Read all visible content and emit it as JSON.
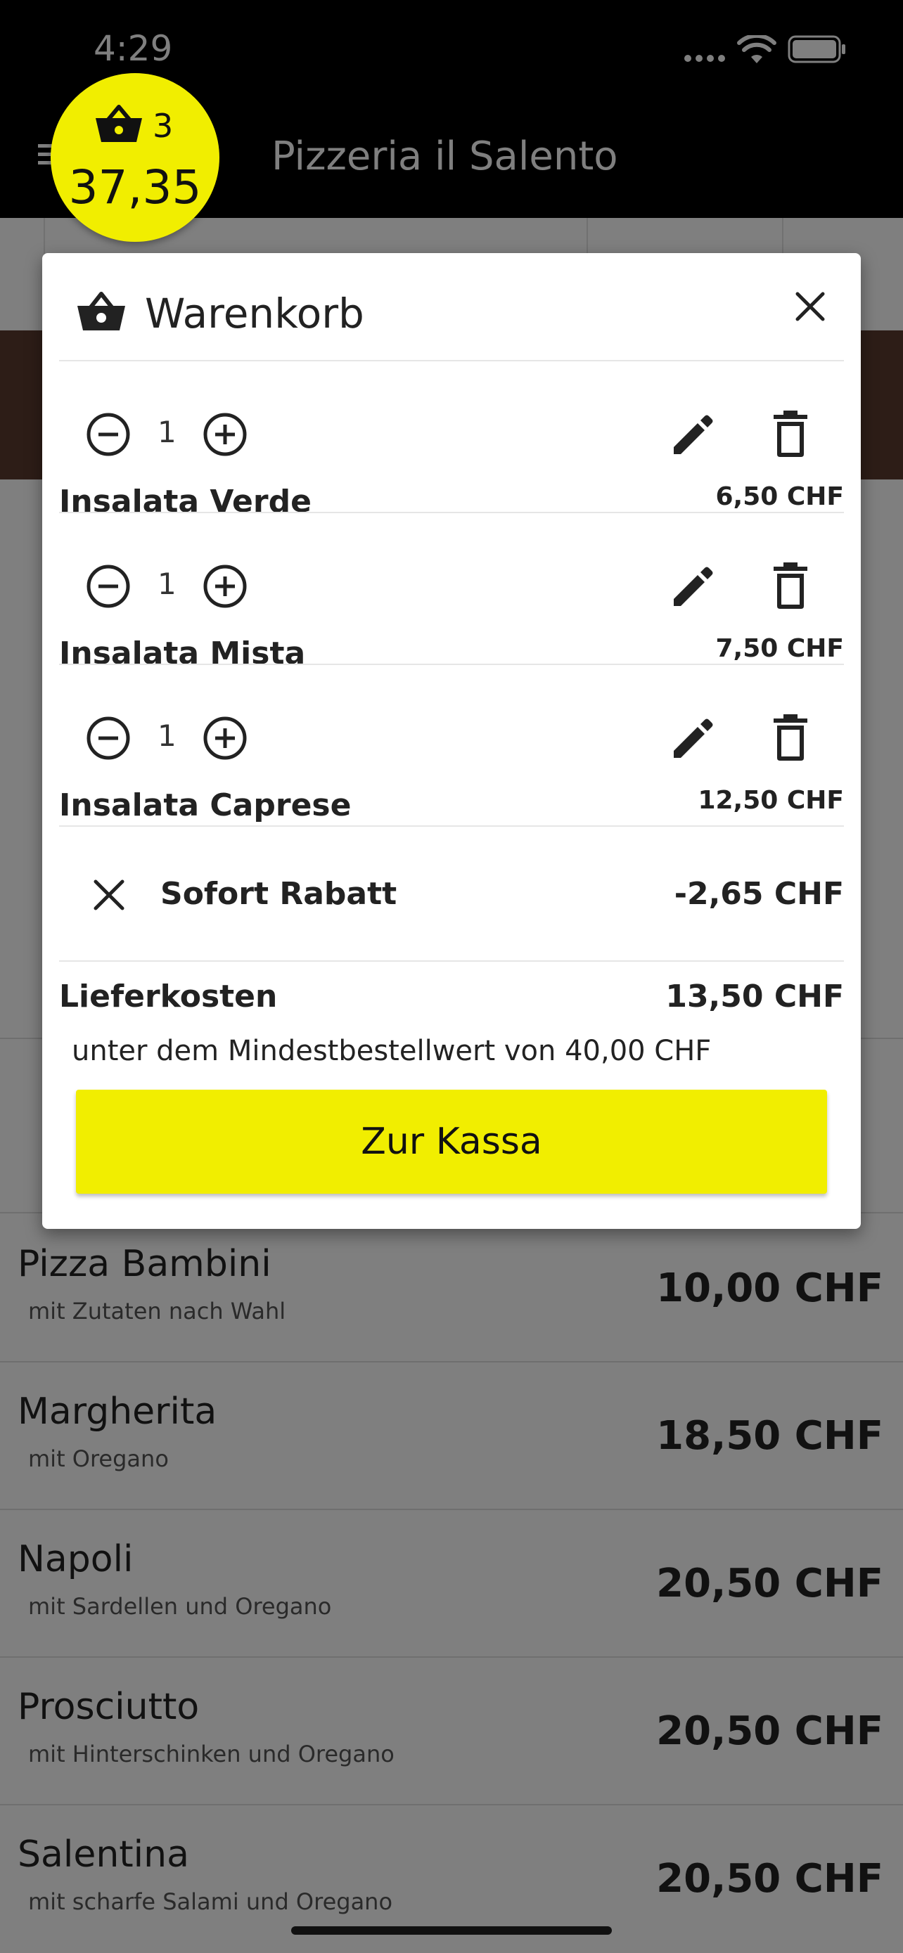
{
  "status_bar": {
    "time": "4:29"
  },
  "app_bar": {
    "title": "Pizzeria il Salento"
  },
  "cart_badge": {
    "count": "3",
    "total": "37,35"
  },
  "menu": [
    {
      "name": "Pizza Bambini",
      "desc": "mit Zutaten nach Wahl",
      "price": "10,00 CHF"
    },
    {
      "name": "Margherita",
      "desc": "mit Oregano",
      "price": "18,50 CHF"
    },
    {
      "name": "Napoli",
      "desc": "mit Sardellen und Oregano",
      "price": "20,50 CHF"
    },
    {
      "name": "Prosciutto",
      "desc": "mit Hinterschinken und Oregano",
      "price": "20,50 CHF"
    },
    {
      "name": "Salentina",
      "desc": "mit scharfe Salami und Oregano",
      "price": "20,50 CHF"
    }
  ],
  "dialog": {
    "title": "Warenkorb",
    "items": [
      {
        "qty": "1",
        "name": "Insalata Verde",
        "price": "6,50 CHF"
      },
      {
        "qty": "1",
        "name": "Insalata Mista",
        "price": "7,50 CHF"
      },
      {
        "qty": "1",
        "name": "Insalata Caprese",
        "price": "12,50 CHF"
      }
    ],
    "discount": {
      "label": "Sofort Rabatt",
      "value": "-2,65 CHF"
    },
    "delivery": {
      "label": "Lieferkosten",
      "value": "13,50 CHF",
      "note": "unter dem Mindestbestellwert von 40,00 CHF"
    },
    "checkout_label": "Zur Kassa"
  },
  "colors": {
    "accent": "#f1ee00",
    "appbar": "#000000"
  },
  "icons": [
    "basket-icon",
    "close-icon",
    "minus-circle-icon",
    "plus-circle-icon",
    "pencil-icon",
    "trash-icon",
    "menu-icon"
  ]
}
